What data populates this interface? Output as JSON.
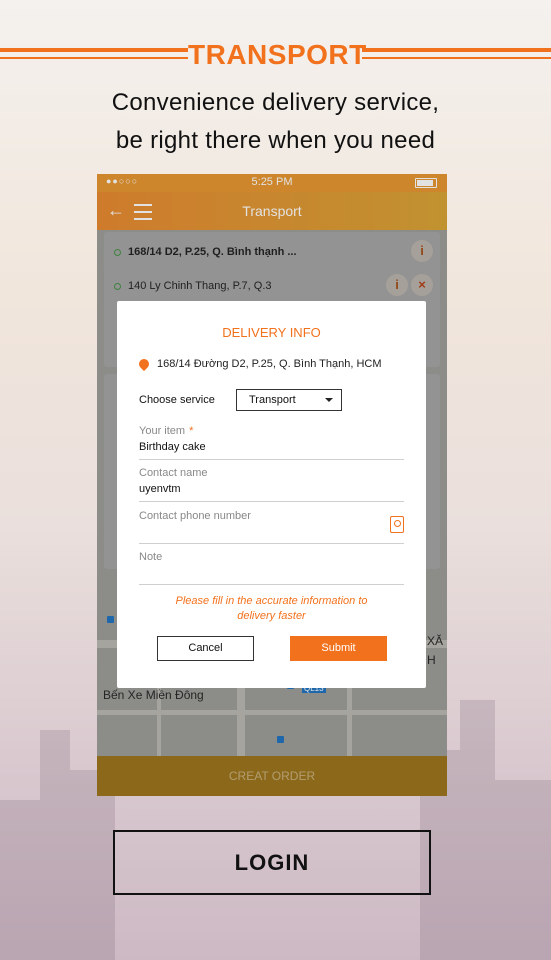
{
  "header": {
    "title": "TRANSPORT"
  },
  "tagline": {
    "line1": "Convenience delivery service,",
    "line2": "be right there when you need"
  },
  "phone": {
    "status": {
      "dots": "●●○○○",
      "time": "5:25 PM"
    },
    "navbar": {
      "back": "←",
      "title": "Transport"
    },
    "route": {
      "from": "168/14 D2, P.25, Q. Bình thạnh ...",
      "to": "140 Ly Chinh Thang, P.7, Q.3",
      "info_icon": "i",
      "remove_icon": "×"
    },
    "map": {
      "label_bus": "Bến Xe Miền Đông",
      "label_xa": "XĂ",
      "label_h": "H",
      "road_badge": "QL13"
    },
    "create_order": "CREAT ORDER"
  },
  "dialog": {
    "title": "DELIVERY INFO",
    "address": "168/14 Đường D2, P.25, Q. Bình Thạnh, HCM",
    "service_label": "Choose service",
    "service_value": "Transport",
    "item_label": "Your item",
    "item_required": "*",
    "item_value": "Birthday cake",
    "contact_label": "Contact name",
    "contact_value": "uyenvtm",
    "phone_label": "Contact phone number",
    "phone_value": "",
    "note_label": "Note",
    "note_value": "",
    "hint_line1": "Please fill in the accurate information to",
    "hint_line2": "delivery faster",
    "cancel": "Cancel",
    "submit": "Submit"
  },
  "login": "LOGIN",
  "colors": {
    "accent": "#f2711c",
    "dark": "#111111"
  }
}
